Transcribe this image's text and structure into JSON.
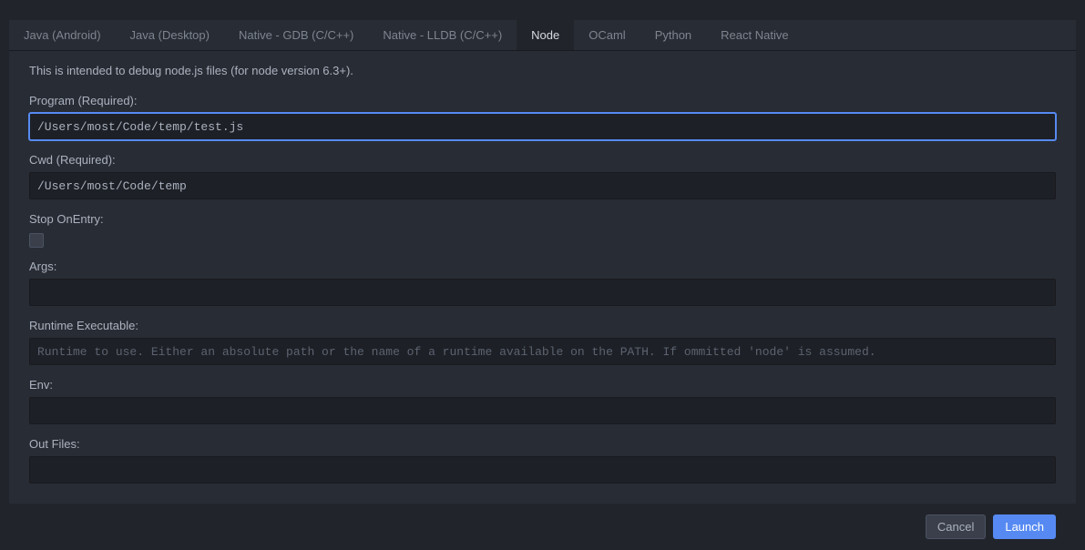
{
  "tabs": {
    "items": [
      {
        "label": "Java (Android)",
        "active": false
      },
      {
        "label": "Java (Desktop)",
        "active": false
      },
      {
        "label": "Native - GDB (C/C++)",
        "active": false
      },
      {
        "label": "Native - LLDB (C/C++)",
        "active": false
      },
      {
        "label": "Node",
        "active": true
      },
      {
        "label": "OCaml",
        "active": false
      },
      {
        "label": "Python",
        "active": false
      },
      {
        "label": "React Native",
        "active": false
      }
    ]
  },
  "description": "This is intended to debug node.js files (for node version 6.3+).",
  "fields": {
    "program": {
      "label": "Program (Required):",
      "value": "/Users/most/Code/temp/test.js"
    },
    "cwd": {
      "label": "Cwd (Required):",
      "value": "/Users/most/Code/temp"
    },
    "stopOnEntry": {
      "label": "Stop OnEntry:"
    },
    "args": {
      "label": "Args:",
      "value": ""
    },
    "runtimeExecutable": {
      "label": "Runtime Executable:",
      "value": "",
      "placeholder": "Runtime to use. Either an absolute path or the name of a runtime available on the PATH. If ommitted 'node' is assumed."
    },
    "env": {
      "label": "Env:",
      "value": ""
    },
    "outFiles": {
      "label": "Out Files:",
      "value": ""
    }
  },
  "buttons": {
    "cancel": "Cancel",
    "launch": "Launch"
  }
}
